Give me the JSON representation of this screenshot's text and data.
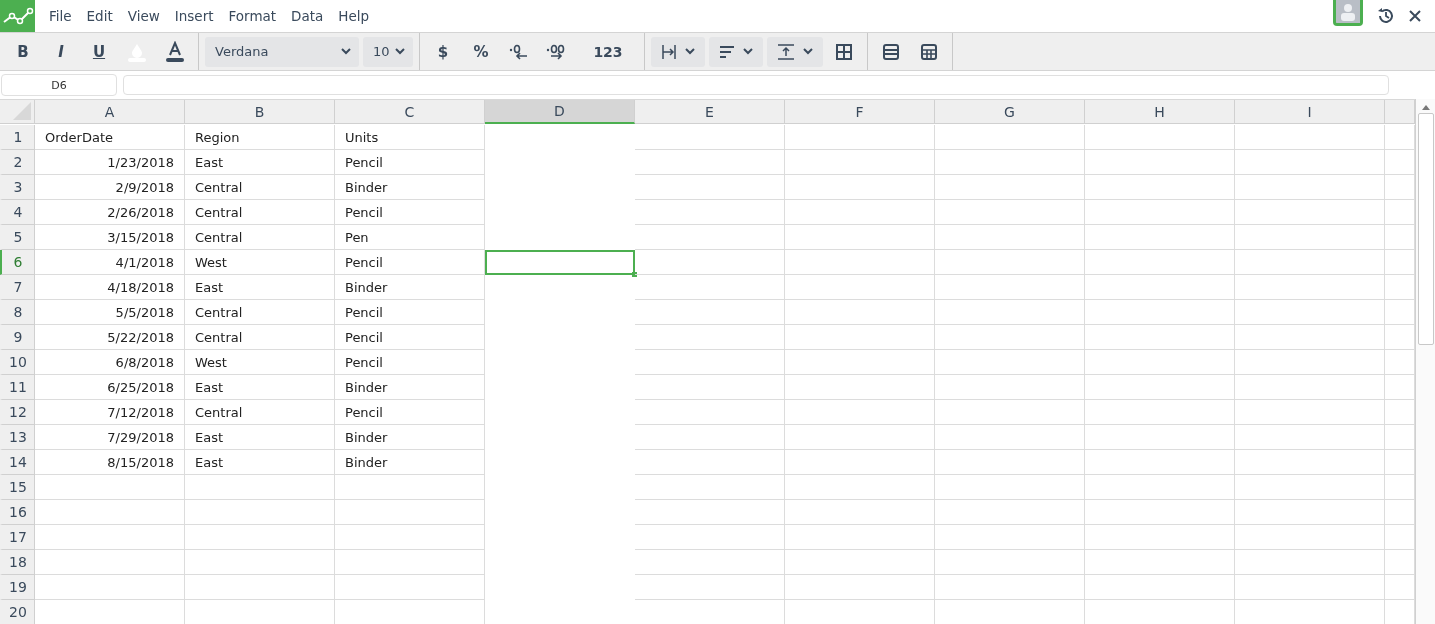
{
  "menu": [
    "File",
    "Edit",
    "View",
    "Insert",
    "Format",
    "Data",
    "Help"
  ],
  "toolbar": {
    "bold": "B",
    "italic": "I",
    "underline": "U",
    "font": "Verdana",
    "size": "10",
    "currency": "$",
    "percent": "%",
    "number_format": "123"
  },
  "name_box": "D6",
  "columns": [
    {
      "label": "A",
      "selected": false
    },
    {
      "label": "B",
      "selected": false
    },
    {
      "label": "C",
      "selected": false
    },
    {
      "label": "D",
      "selected": true
    },
    {
      "label": "E",
      "selected": false
    },
    {
      "label": "F",
      "selected": false
    },
    {
      "label": "G",
      "selected": false
    },
    {
      "label": "H",
      "selected": false
    },
    {
      "label": "I",
      "selected": false
    }
  ],
  "rows": [
    {
      "label": "1",
      "selected": false,
      "cells": [
        {
          "text": "OrderDate",
          "kind": "text"
        },
        {
          "text": "Region",
          "kind": "text"
        },
        {
          "text": "Units",
          "kind": "text"
        }
      ]
    },
    {
      "label": "2",
      "selected": false,
      "cells": [
        {
          "text": "1/23/2018",
          "kind": "number"
        },
        {
          "text": "East",
          "kind": "text"
        },
        {
          "text": "Pencil",
          "kind": "text"
        }
      ]
    },
    {
      "label": "3",
      "selected": false,
      "cells": [
        {
          "text": "2/9/2018",
          "kind": "number"
        },
        {
          "text": "Central",
          "kind": "text"
        },
        {
          "text": "Binder",
          "kind": "text"
        }
      ]
    },
    {
      "label": "4",
      "selected": false,
      "cells": [
        {
          "text": "2/26/2018",
          "kind": "number"
        },
        {
          "text": "Central",
          "kind": "text"
        },
        {
          "text": "Pencil",
          "kind": "text"
        }
      ]
    },
    {
      "label": "5",
      "selected": false,
      "cells": [
        {
          "text": "3/15/2018",
          "kind": "number"
        },
        {
          "text": "Central",
          "kind": "text"
        },
        {
          "text": "Pen",
          "kind": "text"
        }
      ]
    },
    {
      "label": "6",
      "selected": true,
      "cells": [
        {
          "text": "4/1/2018",
          "kind": "number"
        },
        {
          "text": "West",
          "kind": "text"
        },
        {
          "text": "Pencil",
          "kind": "text"
        }
      ]
    },
    {
      "label": "7",
      "selected": false,
      "cells": [
        {
          "text": "4/18/2018",
          "kind": "number"
        },
        {
          "text": "East",
          "kind": "text"
        },
        {
          "text": "Binder",
          "kind": "text"
        }
      ]
    },
    {
      "label": "8",
      "selected": false,
      "cells": [
        {
          "text": "5/5/2018",
          "kind": "number"
        },
        {
          "text": "Central",
          "kind": "text"
        },
        {
          "text": "Pencil",
          "kind": "text"
        }
      ]
    },
    {
      "label": "9",
      "selected": false,
      "cells": [
        {
          "text": "5/22/2018",
          "kind": "number"
        },
        {
          "text": "Central",
          "kind": "text"
        },
        {
          "text": "Pencil",
          "kind": "text"
        }
      ]
    },
    {
      "label": "10",
      "selected": false,
      "cells": [
        {
          "text": "6/8/2018",
          "kind": "number"
        },
        {
          "text": "West",
          "kind": "text"
        },
        {
          "text": "Pencil",
          "kind": "text"
        }
      ]
    },
    {
      "label": "11",
      "selected": false,
      "cells": [
        {
          "text": "6/25/2018",
          "kind": "number"
        },
        {
          "text": "East",
          "kind": "text"
        },
        {
          "text": "Binder",
          "kind": "text"
        }
      ]
    },
    {
      "label": "12",
      "selected": false,
      "cells": [
        {
          "text": "7/12/2018",
          "kind": "number"
        },
        {
          "text": "Central",
          "kind": "text"
        },
        {
          "text": "Pencil",
          "kind": "text"
        }
      ]
    },
    {
      "label": "13",
      "selected": false,
      "cells": [
        {
          "text": "7/29/2018",
          "kind": "number"
        },
        {
          "text": "East",
          "kind": "text"
        },
        {
          "text": "Binder",
          "kind": "text"
        }
      ]
    },
    {
      "label": "14",
      "selected": false,
      "cells": [
        {
          "text": "8/15/2018",
          "kind": "number"
        },
        {
          "text": "East",
          "kind": "text"
        },
        {
          "text": "Binder",
          "kind": "text"
        }
      ]
    },
    {
      "label": "15",
      "selected": false,
      "cells": []
    },
    {
      "label": "16",
      "selected": false,
      "cells": []
    },
    {
      "label": "17",
      "selected": false,
      "cells": []
    },
    {
      "label": "18",
      "selected": false,
      "cells": []
    },
    {
      "label": "19",
      "selected": false,
      "cells": []
    },
    {
      "label": "20",
      "selected": false,
      "cells": []
    }
  ]
}
